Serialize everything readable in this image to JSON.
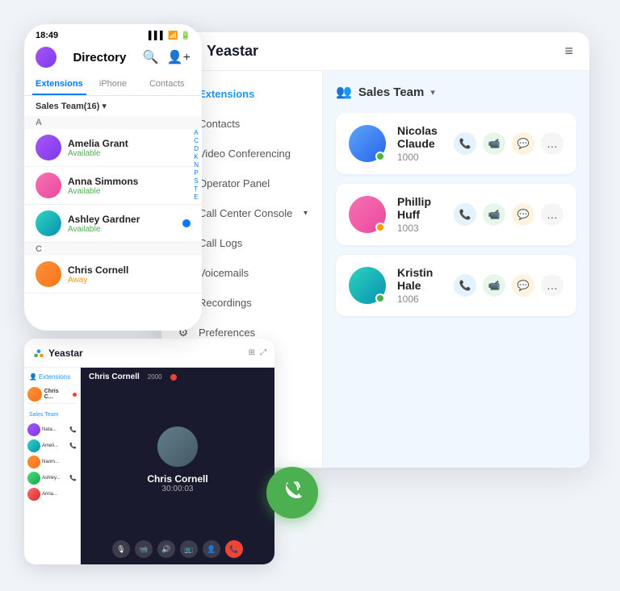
{
  "phone": {
    "status_bar": {
      "time": "18:49",
      "signal": "▌▌▌",
      "wifi": "WiFi",
      "battery": "🔋"
    },
    "header": {
      "title": "Directory",
      "search_icon": "search",
      "add_icon": "add-person"
    },
    "tabs": [
      {
        "label": "Extensions",
        "active": true
      },
      {
        "label": "iPhone",
        "active": false
      },
      {
        "label": "Contacts",
        "active": false
      }
    ],
    "filter": "Sales Team(16)",
    "section_a": "A",
    "contacts": [
      {
        "name": "Amelia Grant",
        "status": "Available",
        "status_class": "available",
        "avatar_class": "av-purple"
      },
      {
        "name": "Anna Simmons",
        "status": "Available",
        "status_class": "available",
        "avatar_class": "av-pink"
      },
      {
        "name": "Ashley Gardner",
        "status": "Available",
        "status_class": "available",
        "avatar_class": "av-teal"
      }
    ],
    "section_c": "C",
    "contact_c": {
      "name": "Chris Cornell",
      "status": "Away",
      "status_class": "away",
      "avatar_class": "av-orange"
    },
    "az_letters": [
      "A",
      "C",
      "D",
      "K",
      "N",
      "P",
      "S",
      "T",
      "E"
    ]
  },
  "desktop": {
    "logo": "Yeastar",
    "menu_icon": "≡",
    "nav_items": [
      {
        "label": "Extensions",
        "icon": "👤",
        "active": true
      },
      {
        "label": "Contacts",
        "icon": "📋",
        "active": false
      },
      {
        "label": "Video Conferencing",
        "icon": "🖥",
        "active": false
      },
      {
        "label": "Operator Panel",
        "icon": "⬛",
        "active": false
      },
      {
        "label": "Call Center Console",
        "icon": "🎧",
        "active": false,
        "has_chevron": true
      },
      {
        "label": "Call Logs",
        "icon": "📄",
        "active": false
      },
      {
        "label": "Voicemails",
        "icon": "🔊",
        "active": false
      },
      {
        "label": "Recordings",
        "icon": "🎙",
        "active": false
      },
      {
        "label": "Preferences",
        "icon": "⚙",
        "active": false
      }
    ],
    "content": {
      "group_icon": "👥",
      "group_name": "Sales Team",
      "contacts": [
        {
          "name": "Nicolas Claude",
          "ext": "1000",
          "status": "green",
          "avatar_class": "av-blue"
        },
        {
          "name": "Phillip Huff",
          "ext": "1003",
          "status": "orange",
          "avatar_class": "av-pink"
        },
        {
          "name": "Kristin Hale",
          "ext": "1006",
          "status": "green",
          "avatar_class": "av-teal"
        }
      ]
    }
  },
  "small_desktop": {
    "logo": "Yeastar",
    "sidebar_label": "Extensions",
    "group_label": "Sales Team",
    "video_call": {
      "caller": "Chris Cornell",
      "ext": "2000",
      "timer": "30:00:03",
      "thumbs": [
        {
          "name": "Nata...",
          "avatar_class": "av-purple"
        },
        {
          "name": "Ameli...",
          "avatar_class": "av-teal"
        },
        {
          "name": "Naomi",
          "avatar_class": "av-orange"
        },
        {
          "name": "Ashley...",
          "avatar_class": "av-green"
        },
        {
          "name": "Anna...",
          "avatar_class": "av-red"
        }
      ]
    }
  },
  "floating_btn": {
    "icon": "📞"
  },
  "colors": {
    "brand_blue": "#2196F3",
    "brand_green": "#4CAF50",
    "background": "#f0f4f8"
  }
}
